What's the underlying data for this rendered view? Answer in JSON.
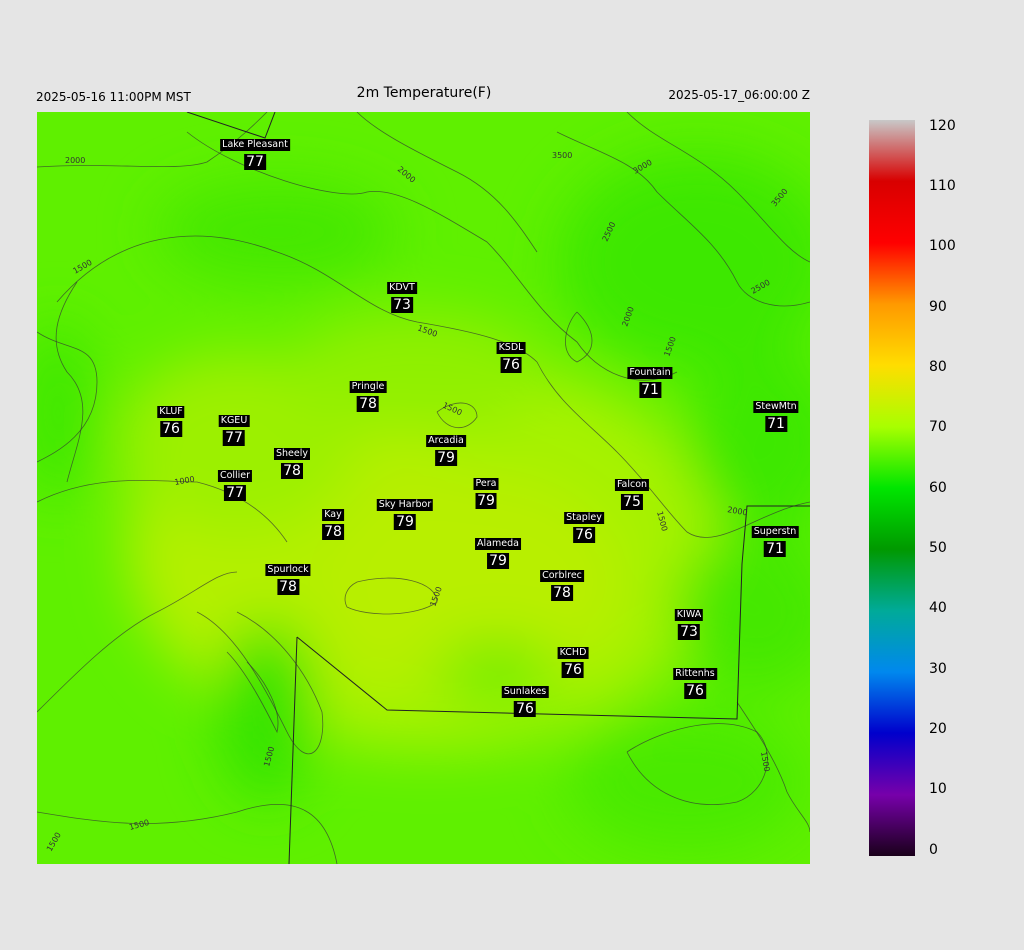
{
  "header": {
    "local_time": "2025-05-16 11:00PM MST",
    "title": "2m Temperature(F)",
    "utc_time": "2025-05-17_06:00:00 Z"
  },
  "stations": [
    {
      "name": "Lake Pleasant",
      "value": "77"
    },
    {
      "name": "KDVT",
      "value": "73"
    },
    {
      "name": "KSDL",
      "value": "76"
    },
    {
      "name": "Fountain",
      "value": "71"
    },
    {
      "name": "StewMtn",
      "value": "71"
    },
    {
      "name": "Pringle",
      "value": "78"
    },
    {
      "name": "KLUF",
      "value": "76"
    },
    {
      "name": "KGEU",
      "value": "77"
    },
    {
      "name": "Arcadia",
      "value": "79"
    },
    {
      "name": "Sheely",
      "value": "78"
    },
    {
      "name": "Collier",
      "value": "77"
    },
    {
      "name": "Pera",
      "value": "79"
    },
    {
      "name": "Falcon",
      "value": "75"
    },
    {
      "name": "Sky Harbor",
      "value": "79"
    },
    {
      "name": "Kay",
      "value": "78"
    },
    {
      "name": "Stapley",
      "value": "76"
    },
    {
      "name": "Superstn",
      "value": "71"
    },
    {
      "name": "Alameda",
      "value": "79"
    },
    {
      "name": "Spurlock",
      "value": "78"
    },
    {
      "name": "Corblrec",
      "value": "78"
    },
    {
      "name": "KIWA",
      "value": "73"
    },
    {
      "name": "KCHD",
      "value": "76"
    },
    {
      "name": "Rittenhs",
      "value": "76"
    },
    {
      "name": "Sunlakes",
      "value": "76"
    }
  ],
  "contour_labels": [
    "2000",
    "2000",
    "3500",
    "3000",
    "2500",
    "3500",
    "2500",
    "1500",
    "1500",
    "2000",
    "1500",
    "1500",
    "1000",
    "1500",
    "2000",
    "1500",
    "1500",
    "1500",
    "1500",
    "1500"
  ],
  "colorbar": {
    "ticks": [
      "120",
      "110",
      "100",
      "90",
      "80",
      "70",
      "60",
      "50",
      "40",
      "30",
      "20",
      "10",
      "0"
    ],
    "colors": [
      "#c8c8c8",
      "#d80000",
      "#ff0000",
      "#ff9900",
      "#ffdd00",
      "#a8ff00",
      "#00e600",
      "#009900",
      "#00aa99",
      "#0088ee",
      "#0000cc",
      "#7700aa",
      "#1a001a"
    ]
  }
}
